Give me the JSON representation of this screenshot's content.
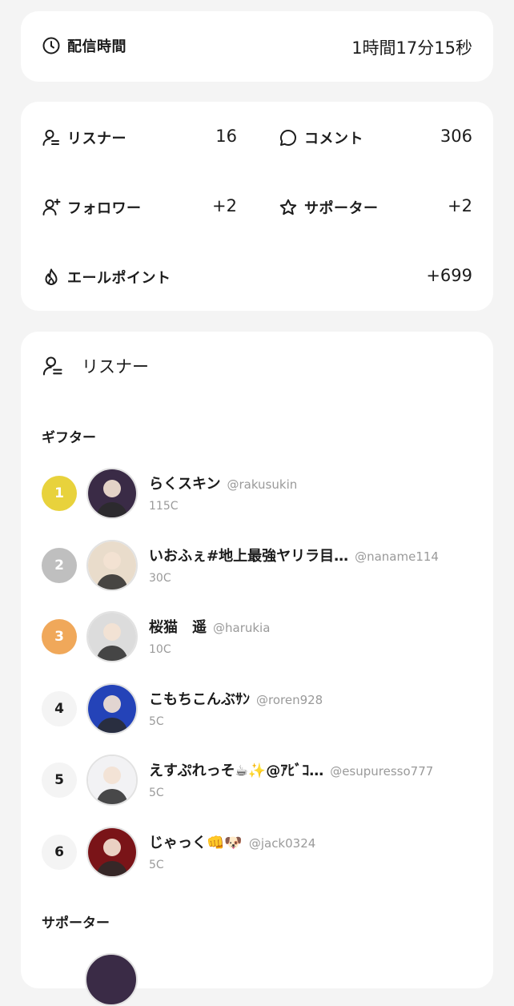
{
  "duration": {
    "label": "配信時間",
    "value": "1時間17分15秒",
    "icon": "clock-icon"
  },
  "stats": {
    "listeners": {
      "label": "リスナー",
      "value": "16",
      "icon": "listener-icon"
    },
    "comments": {
      "label": "コメント",
      "value": "306",
      "icon": "comment-bubble-icon"
    },
    "followers": {
      "label": "フォロワー",
      "value": "+2",
      "icon": "add-user-icon"
    },
    "supporters": {
      "label": "サポーター",
      "value": "+2",
      "icon": "star-icon"
    },
    "yell_points": {
      "label": "エールポイント",
      "value": "+699",
      "icon": "flame-icon"
    }
  },
  "listener_section": {
    "title": "リスナー",
    "gifter_title": "ギフター",
    "supporter_title": "サポーター",
    "gifters": [
      {
        "rank": "1",
        "name": "らくスキン",
        "handle": "@rakusukin",
        "coins": "115C",
        "rank_color": "#e8d23c",
        "rank_text_color": "#ffffff",
        "avatar_color": "#3a2b46"
      },
      {
        "rank": "2",
        "name": "いおふぇ#地上最強ヤリラ目…",
        "handle": "@naname114",
        "coins": "30C",
        "rank_color": "#bfbfbf",
        "rank_text_color": "#ffffff",
        "avatar_color": "#e9dccb"
      },
      {
        "rank": "3",
        "name": "桜猫　遥",
        "handle": "@harukia",
        "coins": "10C",
        "rank_color": "#f0a85a",
        "rank_text_color": "#ffffff",
        "avatar_color": "#dcdcdc"
      },
      {
        "rank": "4",
        "name": "こもちこんぶｻﾝ",
        "handle": "@roren928",
        "coins": "5C",
        "rank_color": "#f4f4f4",
        "rank_text_color": "#1c1c1c",
        "avatar_color": "#2443b8"
      },
      {
        "rank": "5",
        "name": "えすぷれっそ☕✨@ｱﾋﾞｺ…",
        "handle": "@esupuresso777",
        "coins": "5C",
        "rank_color": "#f4f4f4",
        "rank_text_color": "#1c1c1c",
        "avatar_color": "#f2f2f4"
      },
      {
        "rank": "6",
        "name": "じゃっく👊🐶",
        "handle": "@jack0324",
        "coins": "5C",
        "rank_color": "#f4f4f4",
        "rank_text_color": "#1c1c1c",
        "avatar_color": "#7a1418"
      }
    ]
  }
}
